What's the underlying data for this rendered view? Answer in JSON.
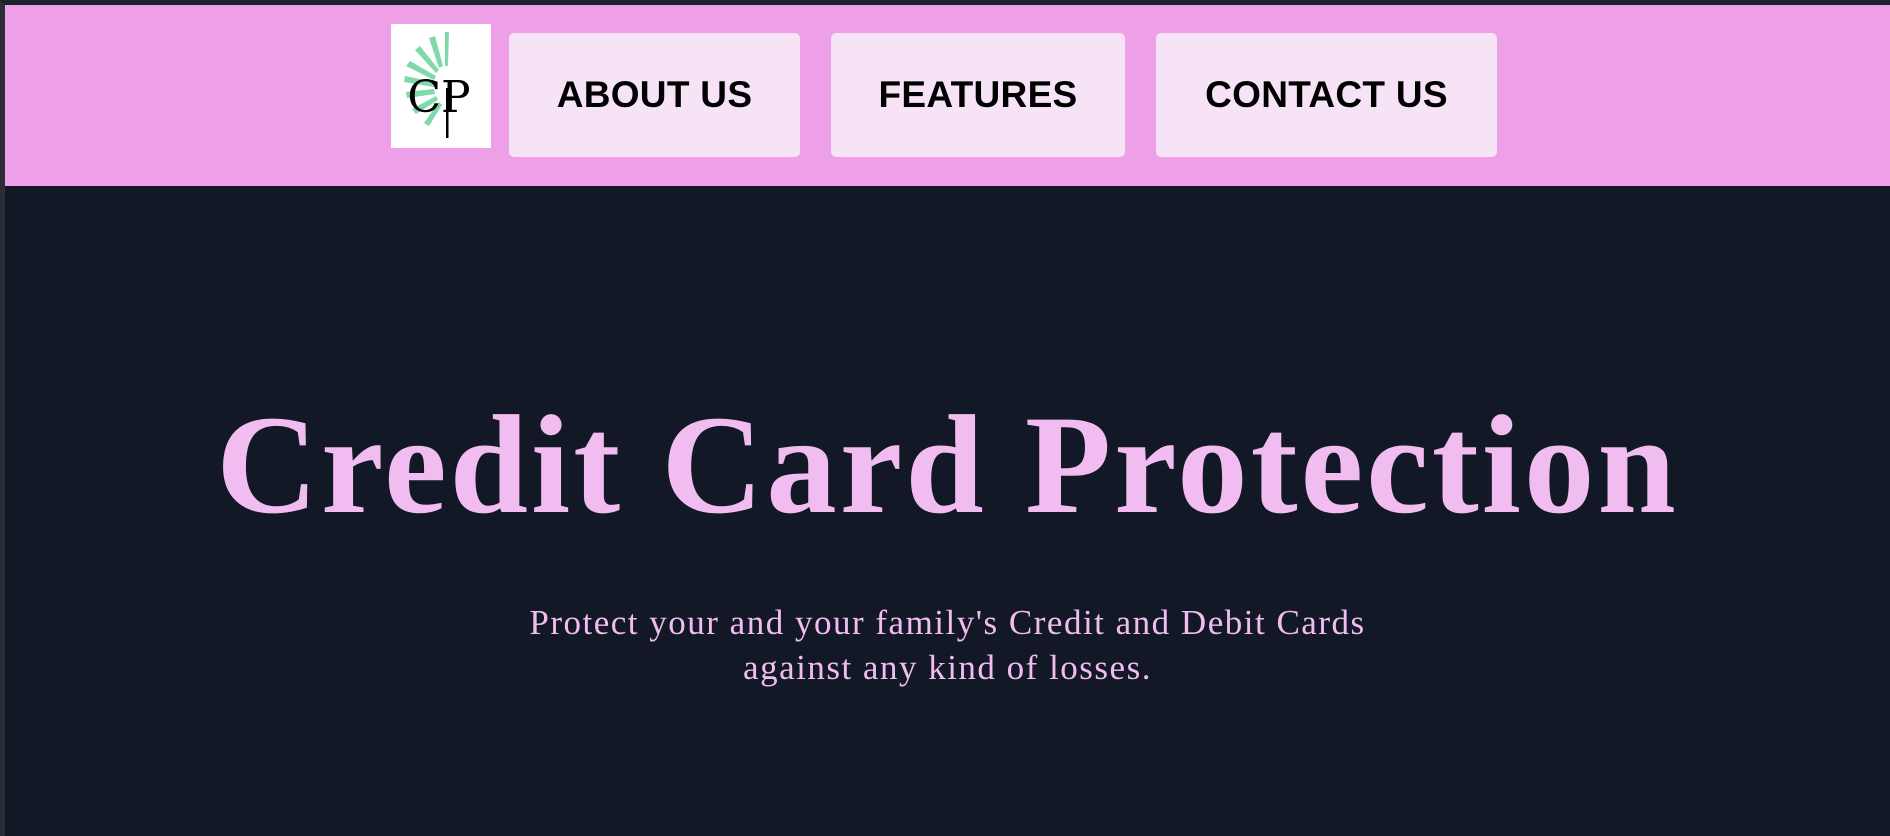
{
  "header": {
    "logo": {
      "text": "CP",
      "icon": "cp-sunburst-logo-icon",
      "accent_color": "#7fd9a8"
    },
    "nav_items": [
      {
        "label": "ABOUT US"
      },
      {
        "label": "FEATURES"
      },
      {
        "label": "CONTACT US"
      }
    ],
    "background_color": "#eda0e8",
    "button_color": "#f6e4f6"
  },
  "hero": {
    "title": "Credit Card Protection",
    "subtitle_line1": "Protect your and your family's Credit and Debit Cards",
    "subtitle_line2": "against any kind of losses.",
    "text_color": "#f1bdf1",
    "background_color": "#131827"
  }
}
